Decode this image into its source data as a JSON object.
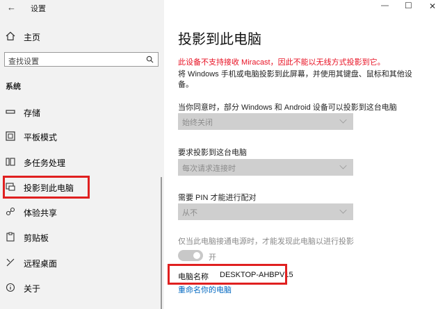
{
  "window": {
    "title": "设置",
    "minimize_glyph": "—",
    "maximize_glyph": "☐",
    "close_glyph": "✕"
  },
  "sidebar": {
    "home_label": "主页",
    "search_placeholder": "查找设置",
    "section_label": "系统",
    "items": [
      {
        "label": "存储",
        "icon": "storage-icon"
      },
      {
        "label": "平板模式",
        "icon": "tablet-mode-icon"
      },
      {
        "label": "多任务处理",
        "icon": "multitasking-icon"
      },
      {
        "label": "投影到此电脑",
        "icon": "project-icon"
      },
      {
        "label": "体验共享",
        "icon": "share-icon"
      },
      {
        "label": "剪贴板",
        "icon": "clipboard-icon"
      },
      {
        "label": "远程桌面",
        "icon": "remote-desktop-icon"
      },
      {
        "label": "关于",
        "icon": "info-icon"
      }
    ]
  },
  "main": {
    "title": "投影到此电脑",
    "warning": "此设备不支持接收 Miracast，因此不能以无线方式投影到它。",
    "description_line1": "将 Windows 手机或电脑投影到此屏幕，并使用其键盘、鼠标和其他设",
    "description_line2": "备。",
    "setting1_label": "当你同意时，部分 Windows 和 Android 设备可以投影到这台电脑",
    "setting1_value": "始终关闭",
    "setting2_label": "要求投影到这台电脑",
    "setting2_value": "每次请求连接时",
    "setting3_label": "需要 PIN 才能进行配对",
    "setting3_value": "从不",
    "power_label": "仅当此电脑接通电源时，才能发现此电脑以进行投影",
    "toggle_text": "开",
    "pc_name_label": "电脑名称",
    "pc_name_value": "DESKTOP-AHBPV15",
    "rename_link": "重命名你的电脑"
  },
  "colors": {
    "accent": "#0067c0",
    "warning": "#e81123",
    "highlight_box": "#e02020",
    "sidebar_bg": "#f2f2f2",
    "dropdown_bg": "#cfcfcf"
  }
}
